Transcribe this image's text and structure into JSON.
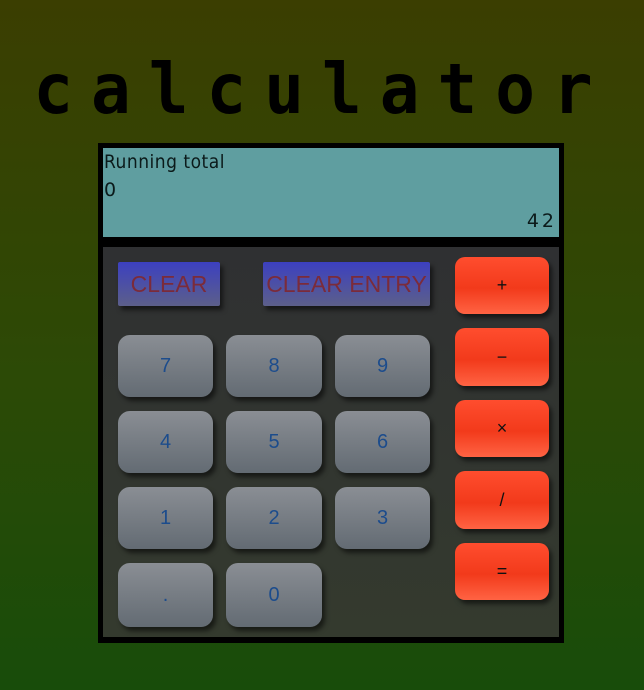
{
  "app": {
    "title": "calculator"
  },
  "display": {
    "running_total_label": "Running total",
    "running_total_value": "0",
    "current_value": "42"
  },
  "controls": {
    "clear_label": "CLEAR",
    "clear_entry_label": "CLEAR ENTRY"
  },
  "keypad": {
    "key_7": "7",
    "key_8": "8",
    "key_9": "9",
    "key_4": "4",
    "key_5": "5",
    "key_6": "6",
    "key_1": "1",
    "key_2": "2",
    "key_3": "3",
    "key_decimal": ".",
    "key_0": "0"
  },
  "operators": {
    "add": "+",
    "subtract": "−",
    "multiply": "×",
    "divide": "/",
    "equals": "="
  },
  "colors": {
    "display_background": "#5f9ea0",
    "operator_button": "#f23a1b",
    "number_button": "#7a7f86",
    "clear_button": "#3c40c0"
  }
}
